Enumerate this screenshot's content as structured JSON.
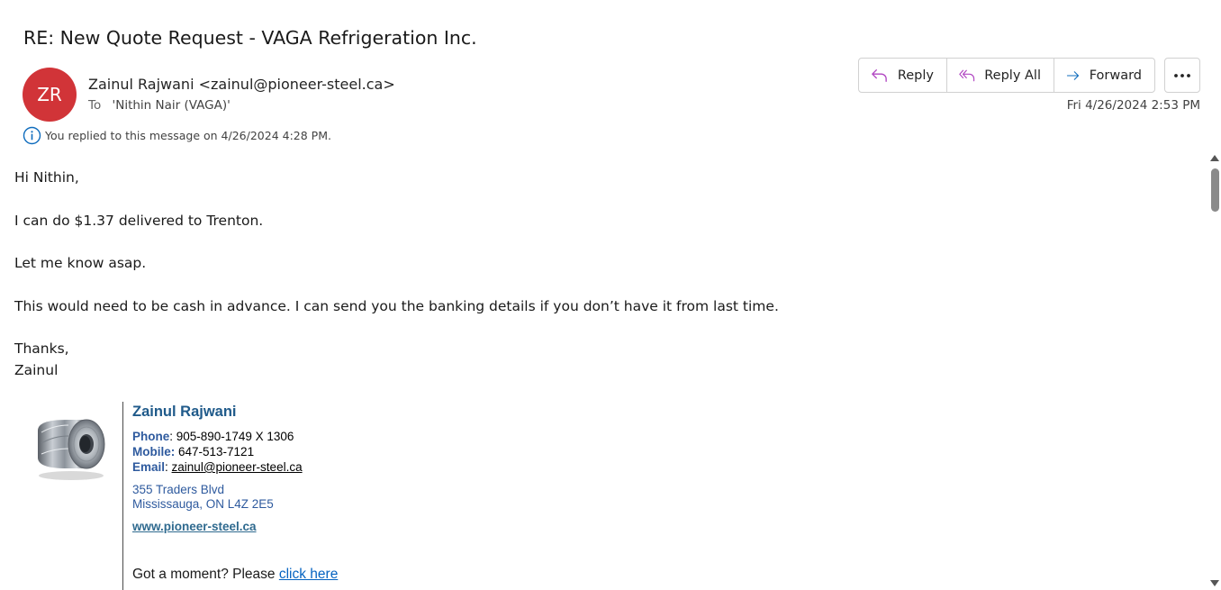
{
  "email": {
    "subject": "RE: New Quote Request - VAGA Refrigeration Inc.",
    "avatar_initials": "ZR",
    "avatar_color": "#d13438",
    "sender": "Zainul Rajwani <zainul@pioneer-steel.ca>",
    "to_label": "To",
    "to_value": "'Nithin Nair (VAGA)'",
    "info_icon": "info-icon",
    "info_text": "You replied to this message on 4/26/2024 4:28 PM.",
    "date": "Fri 4/26/2024 2:53 PM"
  },
  "actions": {
    "reply": {
      "label": "Reply",
      "icon": "reply-icon"
    },
    "reply_all": {
      "label": "Reply All",
      "icon": "reply-all-icon"
    },
    "forward": {
      "label": "Forward",
      "icon": "forward-icon"
    },
    "more": {
      "icon": "more-options-icon"
    },
    "reply_color": "#b146c2",
    "forward_color": "#0f6cbd"
  },
  "body": {
    "greeting": "Hi Nithin,",
    "line1": "I can do $1.37 delivered to Trenton.",
    "line2": "Let me know asap.",
    "line3": "This would need to be cash in advance. I can send you the banking details if you don’t have it from last time.",
    "closing": "Thanks,",
    "signoff": "Zainul"
  },
  "signature": {
    "image": "steel-coil-image",
    "name": "Zainul Rajwani",
    "phone_label": "Phone",
    "phone": ": 905-890-1749 X 1306",
    "mobile_label": "Mobile:",
    "mobile": " 647-513-7121",
    "email_label": "Email",
    "email_sep": ": ",
    "email": "zainul@pioneer-steel.ca",
    "address_line1": "355 Traders Blvd",
    "address_line2": "Mississauga, ON L4Z 2E5",
    "website": "www.pioneer-steel.ca",
    "prompt_text": "Got a moment? Please ",
    "prompt_link": "click here"
  }
}
